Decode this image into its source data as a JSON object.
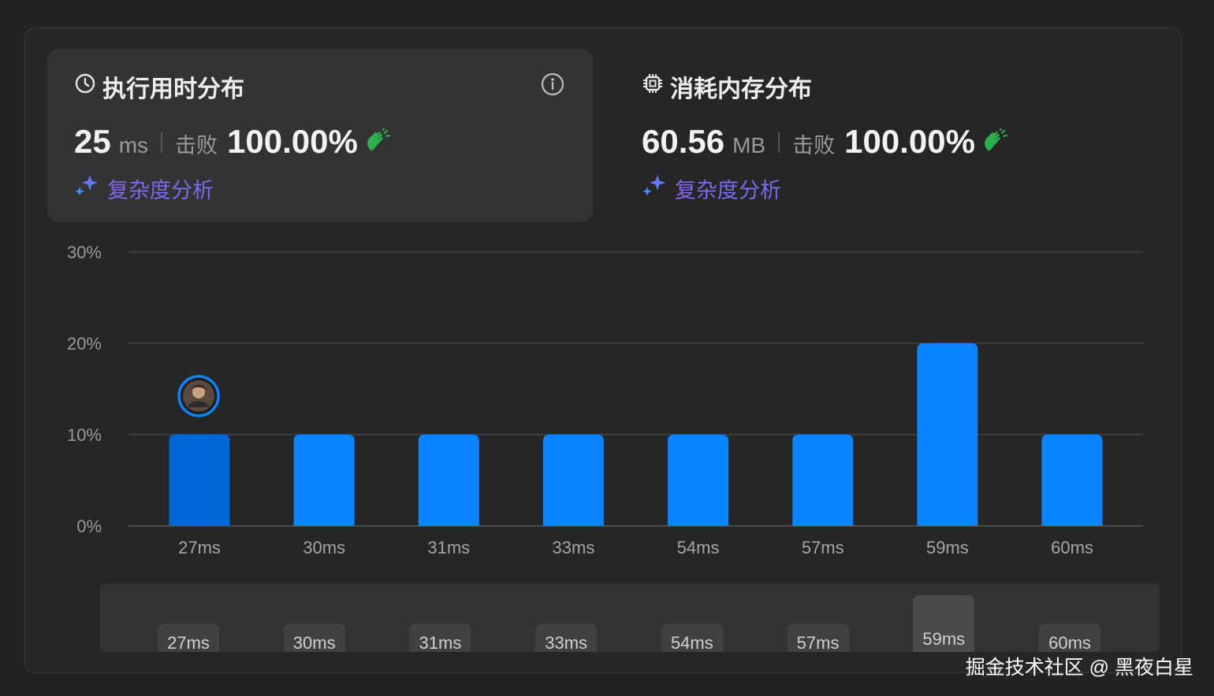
{
  "runtime": {
    "title": "执行用时分布",
    "value": "25",
    "unit": "ms",
    "beat_label": "击败",
    "beat_percent": "100.00%",
    "analysis_label": "复杂度分析"
  },
  "memory": {
    "title": "消耗内存分布",
    "value": "60.56",
    "unit": "MB",
    "beat_label": "击败",
    "beat_percent": "100.00%",
    "analysis_label": "复杂度分析"
  },
  "icons": {
    "runtime": "clock-icon",
    "memory": "chip-icon",
    "info": "info-icon",
    "clap": "clapping-hands-icon",
    "sparkle": "sparkle-icon",
    "avatar": "user-avatar"
  },
  "colors": {
    "bar": "#0a84ff",
    "bar_selected": "#0068d6",
    "beat": "#2bb24c",
    "accent_purple": "#8a63f0",
    "accent_blue": "#3d8bff"
  },
  "chart_data": {
    "type": "bar",
    "categories": [
      "27ms",
      "30ms",
      "31ms",
      "33ms",
      "54ms",
      "57ms",
      "59ms",
      "60ms"
    ],
    "values": [
      10,
      10,
      10,
      10,
      10,
      10,
      20,
      10
    ],
    "y_ticks": [
      "0%",
      "10%",
      "20%",
      "30%"
    ],
    "ylim": [
      0,
      30
    ],
    "y_unit": "%",
    "highlight_category": "27ms",
    "grid": true
  },
  "slider": {
    "labels": [
      "27ms",
      "30ms",
      "31ms",
      "33ms",
      "54ms",
      "57ms",
      "59ms",
      "60ms"
    ]
  },
  "watermark": "掘金技术社区 @ 黑夜白星"
}
